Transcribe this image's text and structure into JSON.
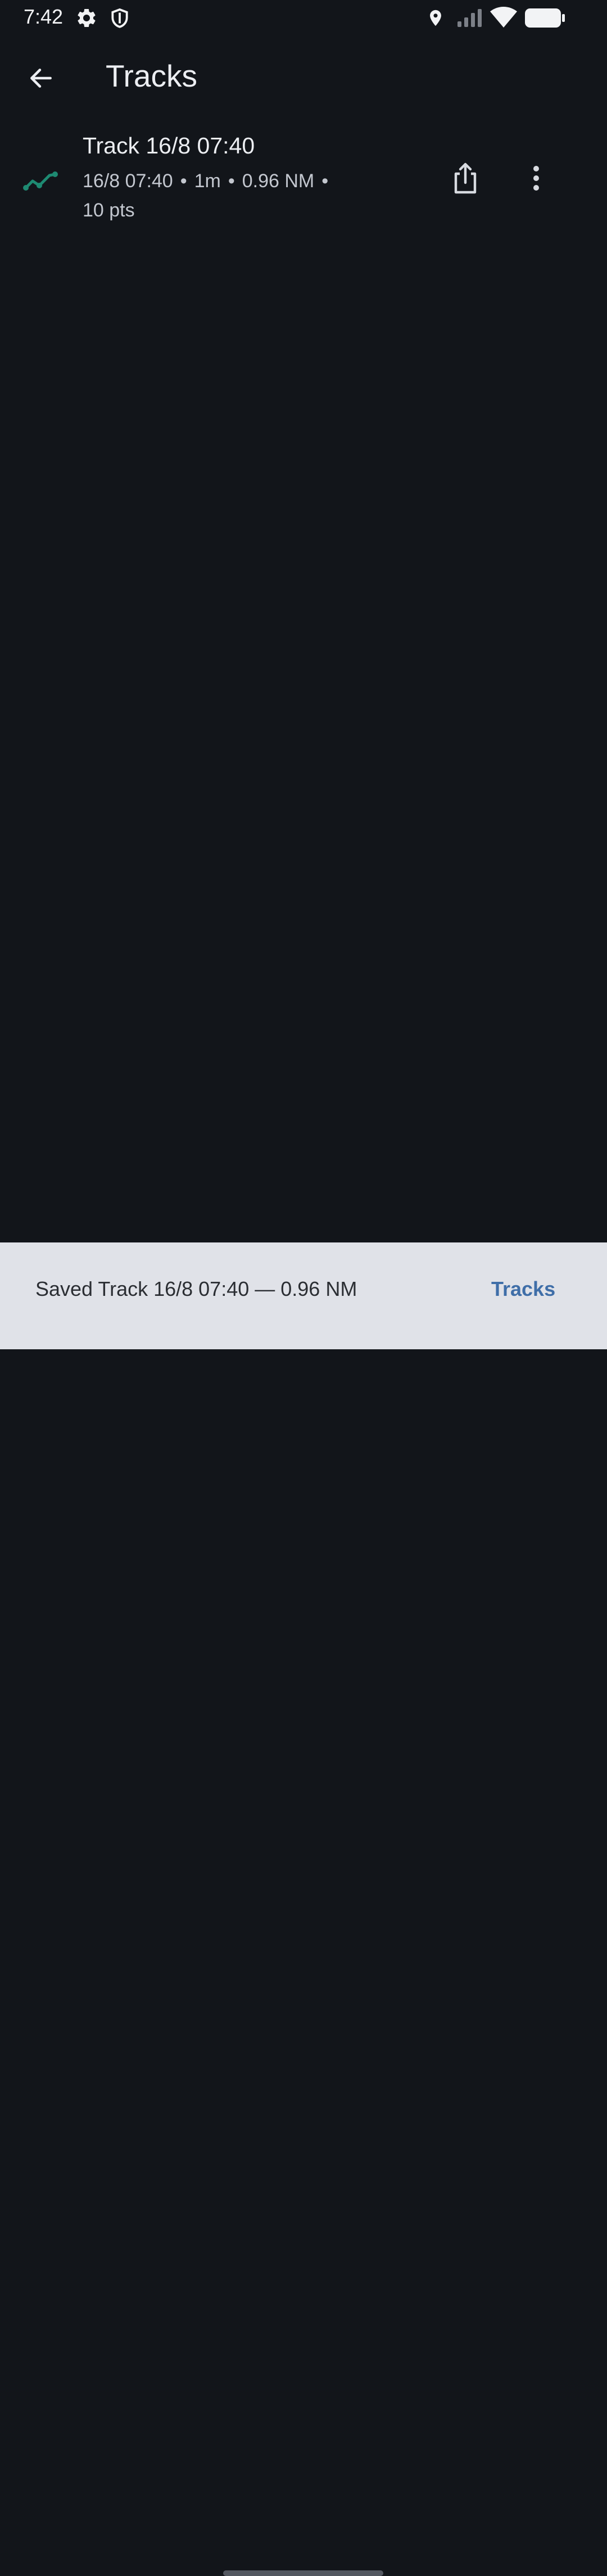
{
  "status_bar": {
    "time": "7:42",
    "icons": [
      "settings-icon",
      "shield-icon",
      "location-icon",
      "signal-icon",
      "wifi-icon",
      "battery-icon"
    ]
  },
  "app_bar": {
    "title": "Tracks",
    "back_icon": "arrow-back-icon"
  },
  "tracks": [
    {
      "title": "Track 16/8 07:40",
      "date": "16/8 07:40",
      "duration": "1m",
      "distance": "0.96 NM",
      "points": "10 pts",
      "separator": "•",
      "icon": "track-line-icon",
      "actions": [
        "share-icon",
        "more-vertical-icon"
      ]
    }
  ],
  "snackbar": {
    "message": "Saved Track 16/8 07:40 — 0.96 NM",
    "action_label": "Tracks"
  },
  "colors": {
    "background": "#12151a",
    "track_icon": "#1e8a72",
    "snackbar_bg": "#e0e2e8",
    "snackbar_action": "#3f6ea8"
  }
}
